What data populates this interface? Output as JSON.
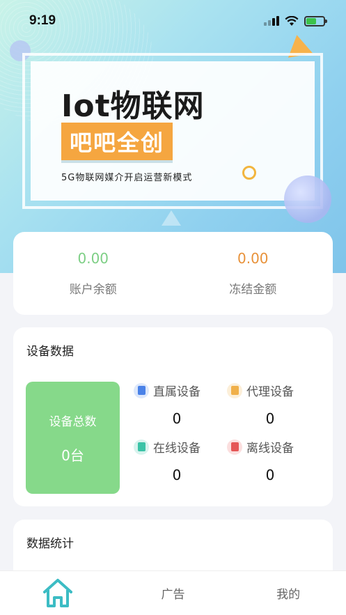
{
  "status_bar": {
    "time": "9:19",
    "battery_level": 0.6
  },
  "banner": {
    "title": "Iot物联网",
    "tag": "吧吧全创",
    "subtitle": "5G物联网媒介开启运营新模式"
  },
  "balance": {
    "account": {
      "value": "0.00",
      "label": "账户余额",
      "color": "#7dcf85"
    },
    "frozen": {
      "value": "0.00",
      "label": "冻结金额",
      "color": "#e8923a"
    }
  },
  "device": {
    "title": "设备数据",
    "total_label": "设备总数",
    "total_value": "0台",
    "stats": [
      {
        "label": "直属设备",
        "value": "0",
        "icon": "direct-device-icon",
        "color": "#4a82e8",
        "bg": "#dde8fb"
      },
      {
        "label": "代理设备",
        "value": "0",
        "icon": "agent-device-icon",
        "color": "#f0b04a",
        "bg": "#fcefd9"
      },
      {
        "label": "在线设备",
        "value": "0",
        "icon": "online-device-icon",
        "color": "#3cc3a7",
        "bg": "#d8f3ee"
      },
      {
        "label": "离线设备",
        "value": "0",
        "icon": "offline-device-icon",
        "color": "#e55656",
        "bg": "#fbdfdf"
      }
    ]
  },
  "stats_section": {
    "title": "数据统计"
  },
  "tabbar": {
    "home_icon": "home-icon",
    "ads": "广告",
    "mine": "我的",
    "active_color": "#3cbcc4"
  }
}
